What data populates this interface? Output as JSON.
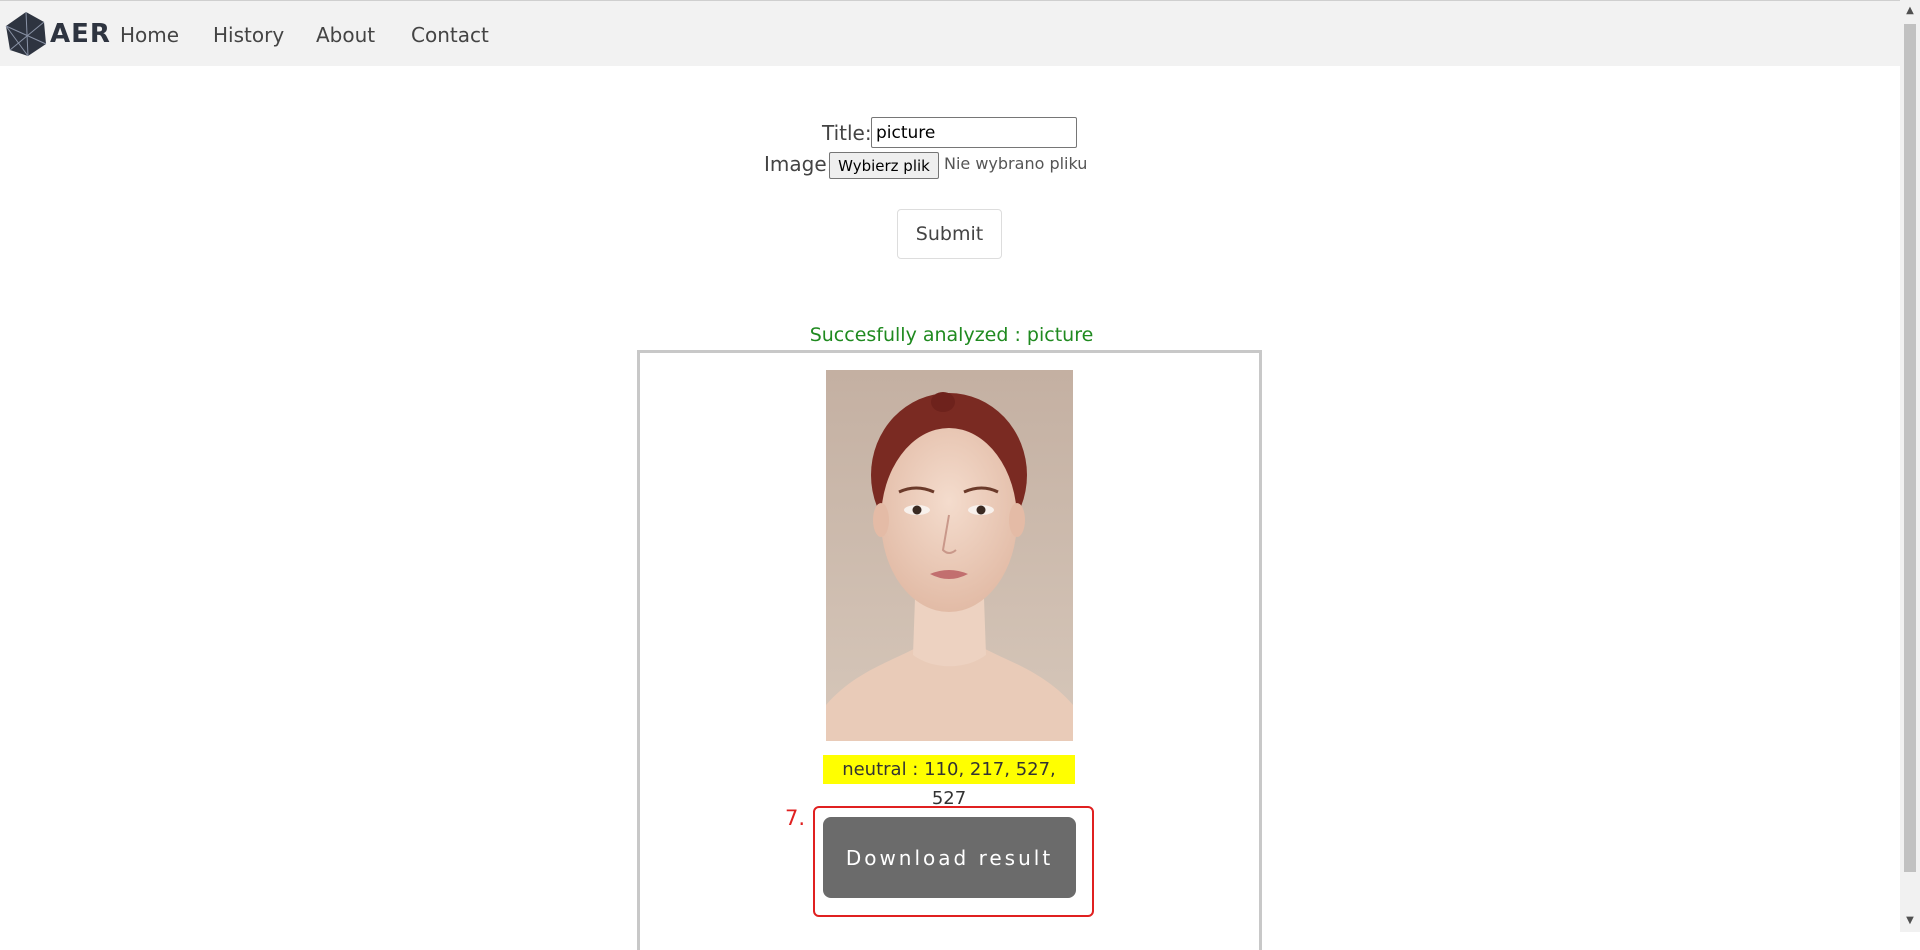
{
  "nav": {
    "logo_text": "AER",
    "links": [
      "Home",
      "History",
      "About",
      "Contact"
    ]
  },
  "form": {
    "title_label": "Title:",
    "title_value": "picture",
    "image_label": "Image:",
    "file_button_label": "Wybierz plik",
    "file_status": "Nie wybrano pliku",
    "submit_label": "Submit"
  },
  "result": {
    "status_message": "Succesfully analyzed : picture",
    "detection_label": "neutral : 110, 217, 527, 527",
    "step_marker": "7.",
    "download_label": "Download result"
  },
  "colors": {
    "nav_bg": "#f2f2f2",
    "success_text": "#1f8a1f",
    "highlight": "#ffff00",
    "download_bg": "#6b6b6b",
    "annotation": "#e02020"
  },
  "icons": {
    "logo": "geometric-hexagon-logo-icon",
    "scroll_up": "scroll-up-arrow-icon",
    "scroll_down": "scroll-down-arrow-icon"
  }
}
